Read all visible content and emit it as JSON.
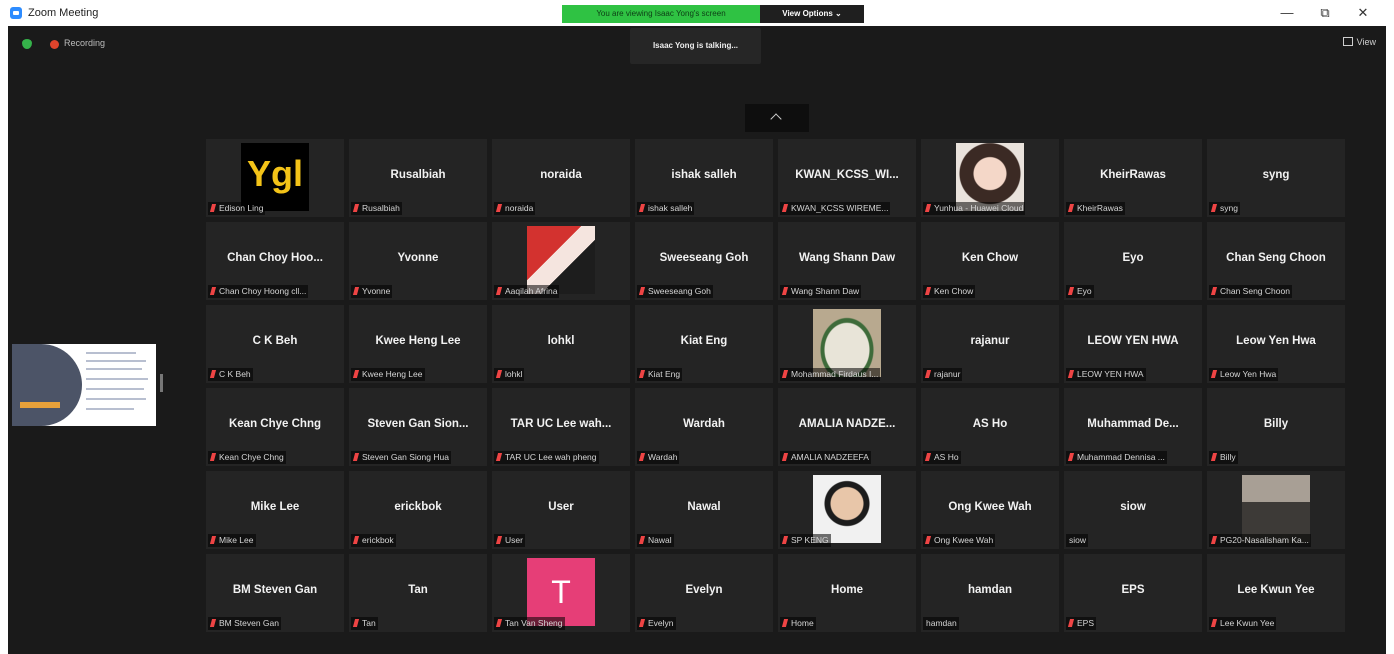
{
  "window": {
    "title": "Zoom Meeting",
    "minimize": "—",
    "restore": "⧉",
    "close": "✕"
  },
  "share_banner": {
    "text": "You are viewing Isaac Yong's screen",
    "view_options": "View Options ⌄"
  },
  "toolbar": {
    "recording": "Recording",
    "talking": "Isaac Yong is talking...",
    "view": "View"
  },
  "colors": {
    "stage": "#1a1a1a",
    "tile": "#242424",
    "banner": "#2fc243",
    "mute": "#e44444",
    "avatar_T": "#e63e77"
  },
  "participants": [
    {
      "name": "",
      "label": "Edison Ling",
      "muted": true,
      "media": "logo-ygl"
    },
    {
      "name": "Rusalbiah",
      "label": "Rusalbiah",
      "muted": true
    },
    {
      "name": "noraida",
      "label": "noraida",
      "muted": true
    },
    {
      "name": "ishak salleh",
      "label": "ishak salleh",
      "muted": true
    },
    {
      "name": "KWAN_KCSS_WI...",
      "label": "KWAN_KCSS WIREME...",
      "muted": true
    },
    {
      "name": "",
      "label": "Yunhua - Huawei Cloud",
      "muted": true,
      "media": "photo-woman"
    },
    {
      "name": "KheirRawas",
      "label": "KheirRawas",
      "muted": true
    },
    {
      "name": "syng",
      "label": "syng",
      "muted": true
    },
    {
      "name": "Chan Choy Hoo...",
      "label": "Chan Choy Hoong cll...",
      "muted": true
    },
    {
      "name": "Yvonne",
      "label": "Yvonne",
      "muted": true
    },
    {
      "name": "",
      "label": "Aaqilah Afrina",
      "muted": true,
      "media": "photo-woman-2"
    },
    {
      "name": "Sweeseang Goh",
      "label": "Sweeseang Goh",
      "muted": true
    },
    {
      "name": "Wang Shann Daw",
      "label": "Wang Shann Daw",
      "muted": true
    },
    {
      "name": "Ken Chow",
      "label": "Ken Chow",
      "muted": true
    },
    {
      "name": "Eyo",
      "label": "Eyo",
      "muted": true
    },
    {
      "name": "Chan Seng Choon",
      "label": "Chan Seng Choon",
      "muted": true
    },
    {
      "name": "C K Beh",
      "label": "C K Beh",
      "muted": true
    },
    {
      "name": "Kwee Heng Lee",
      "label": "Kwee Heng Lee",
      "muted": true
    },
    {
      "name": "lohkl",
      "label": "lohkl",
      "muted": true
    },
    {
      "name": "Kiat Eng",
      "label": "Kiat Eng",
      "muted": true
    },
    {
      "name": "",
      "label": "Mohammad Firdaus I...",
      "muted": true,
      "media": "photo-food"
    },
    {
      "name": "rajanur",
      "label": "rajanur",
      "muted": true
    },
    {
      "name": "LEOW YEN HWA",
      "label": "LEOW YEN HWA",
      "muted": true
    },
    {
      "name": "Leow Yen Hwa",
      "label": "Leow Yen Hwa",
      "muted": true
    },
    {
      "name": "Kean Chye Chng",
      "label": "Kean Chye Chng",
      "muted": true
    },
    {
      "name": "Steven Gan Sion...",
      "label": "Steven Gan Siong Hua",
      "muted": true
    },
    {
      "name": "TAR UC Lee wah...",
      "label": "TAR UC Lee wah pheng",
      "muted": true
    },
    {
      "name": "Wardah",
      "label": "Wardah",
      "muted": true
    },
    {
      "name": "AMALIA NADZE...",
      "label": "AMALIA NADZEEFA",
      "muted": true
    },
    {
      "name": "AS Ho",
      "label": "AS Ho",
      "muted": true
    },
    {
      "name": "Muhammad De...",
      "label": "Muhammad Dennisa ...",
      "muted": true
    },
    {
      "name": "Billy",
      "label": "Billy",
      "muted": true
    },
    {
      "name": "Mike Lee",
      "label": "Mike Lee",
      "muted": true
    },
    {
      "name": "erickbok",
      "label": "erickbok",
      "muted": true
    },
    {
      "name": "User",
      "label": "User",
      "muted": true
    },
    {
      "name": "Nawal",
      "label": "Nawal",
      "muted": true
    },
    {
      "name": "",
      "label": "SP KENG",
      "muted": true,
      "media": "photo-man"
    },
    {
      "name": "Ong Kwee Wah",
      "label": "Ong Kwee Wah",
      "muted": true
    },
    {
      "name": "siow",
      "label": "siow",
      "muted": false
    },
    {
      "name": "",
      "label": "PG20-Nasalisham Ka...",
      "muted": true,
      "media": "photo-group"
    },
    {
      "name": "BM Steven Gan",
      "label": "BM Steven Gan",
      "muted": true
    },
    {
      "name": "Tan",
      "label": "Tan",
      "muted": true
    },
    {
      "name": "",
      "label": "Tan Van Sheng",
      "muted": true,
      "media": "avatar-T"
    },
    {
      "name": "Evelyn",
      "label": "Evelyn",
      "muted": true
    },
    {
      "name": "Home",
      "label": "Home",
      "muted": true
    },
    {
      "name": "hamdan",
      "label": "hamdan",
      "muted": false
    },
    {
      "name": "EPS",
      "label": "EPS",
      "muted": true
    },
    {
      "name": "Lee Kwun Yee",
      "label": "Lee Kwun Yee",
      "muted": true
    }
  ]
}
